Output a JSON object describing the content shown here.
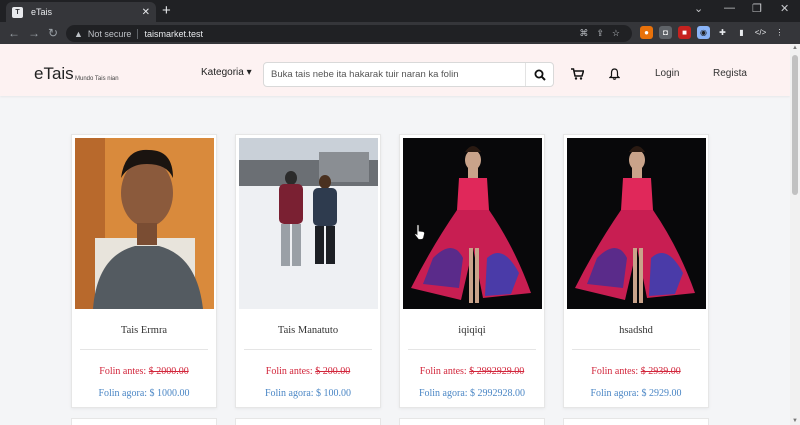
{
  "browser": {
    "tab_title": "eTais",
    "url": "taismarket.test",
    "security_label": "Not secure"
  },
  "site": {
    "logo": "eTais",
    "tagline": "Mundo Tais nian",
    "category_label": "Kategoria",
    "search_placeholder": "Buka tais nebe ita hakarak tuir naran ka folin",
    "login_label": "Login",
    "register_label": "Regista"
  },
  "products": [
    {
      "name": "Tais Ermra",
      "old_label": "Folin antes:",
      "old_price": "$ 2000.00",
      "new_label": "Folin agora:",
      "new_price": "$ 1000.00",
      "image": "man-portrait-photo"
    },
    {
      "name": "Tais Manatuto",
      "old_label": "Folin antes:",
      "old_price": "$ 200.00",
      "new_label": "Folin agora:",
      "new_price": "$ 100.00",
      "image": "snow-photo"
    },
    {
      "name": "iqiqiqi",
      "old_label": "Folin antes:",
      "old_price": "$ 2992929.00",
      "new_label": "Folin agora:",
      "new_price": "$ 2992928.00",
      "image": "tais-dress-photo"
    },
    {
      "name": "hsadshd",
      "old_label": "Folin antes:",
      "old_price": "$ 2939.00",
      "new_label": "Folin agora:",
      "new_price": "$ 2929.00",
      "image": "tais-dress-photo"
    }
  ],
  "colors": {
    "old_price": "#d2273c",
    "new_price": "#4a86c5",
    "header_bg": "#fdf2f2"
  }
}
